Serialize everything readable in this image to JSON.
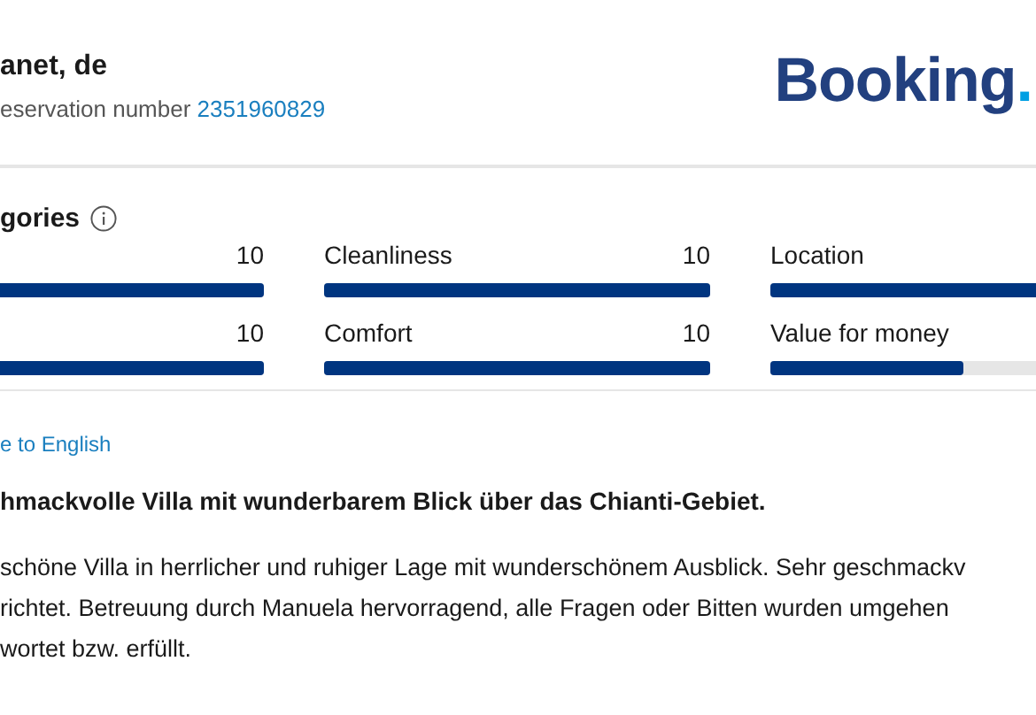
{
  "guest": {
    "name": "anet, de",
    "reservation_label": "eservation number",
    "reservation_number": "2351960829"
  },
  "logo": {
    "main": "Booking",
    "suffix": "."
  },
  "categories": {
    "title": "gories",
    "items": [
      {
        "score": "10",
        "level": 1
      },
      {
        "label": "Cleanliness",
        "score": "10",
        "level": 1
      },
      {
        "label": "Location",
        "level": 1
      },
      {
        "score": "10",
        "level": 1
      },
      {
        "label": "Comfort",
        "score": "10",
        "level": 1
      },
      {
        "label": "Value for money",
        "level": 0.5
      }
    ]
  },
  "translate_link": "e to English",
  "review": {
    "title": "hmackvolle Villa mit wunderbarem Blick über das Chianti-Gebiet.",
    "lines": [
      "schöne Villa in herrlicher und ruhiger Lage mit wunderschönem Ausblick. Sehr geschmackv",
      "richtet. Betreuung durch Manuela hervorragend, alle Fragen oder Bitten wurden umgehen",
      "wortet bzw. erfüllt."
    ]
  }
}
